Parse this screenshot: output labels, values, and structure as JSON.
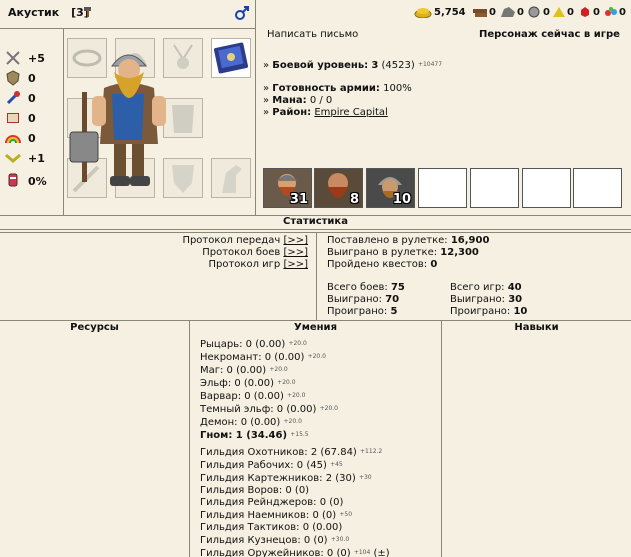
{
  "header": {
    "name": "Акустик",
    "level": "[3]",
    "resources": [
      {
        "icon": "gold-icon",
        "value": "5,754"
      },
      {
        "icon": "wood-icon",
        "value": "0"
      },
      {
        "icon": "ore-icon",
        "value": "0"
      },
      {
        "icon": "mercury-icon",
        "value": "0"
      },
      {
        "icon": "sulfur-icon",
        "value": "0"
      },
      {
        "icon": "crystal-icon",
        "value": "0"
      },
      {
        "icon": "gem-icon",
        "value": "0"
      }
    ]
  },
  "stats": [
    {
      "icon": "attack-icon",
      "value": "+5"
    },
    {
      "icon": "defense-icon",
      "value": "0"
    },
    {
      "icon": "spellpower-icon",
      "value": "0"
    },
    {
      "icon": "knowledge-icon",
      "value": "0"
    },
    {
      "icon": "luck-icon",
      "value": "0"
    },
    {
      "icon": "morale-icon",
      "value": "+1"
    },
    {
      "icon": "initiative-icon",
      "value": "0%"
    }
  ],
  "info": {
    "write_letter": "Написать письмо",
    "in_game": "Персонаж сейчас в игре",
    "combat_level_label": "Боевой уровень:",
    "combat_level_value": "3",
    "combat_level_exp": "(4523)",
    "combat_level_next": "+10477",
    "army_ready_label": "Готовность армии:",
    "army_ready_value": "100%",
    "mana_label": "Мана:",
    "mana_value": "0 / 0",
    "district_label": "Район:",
    "district_value": "Empire Capital"
  },
  "army": [
    {
      "name": "dwarf-warrior",
      "count": "31"
    },
    {
      "name": "dwarf-bearded",
      "count": "8"
    },
    {
      "name": "dwarf-helmet",
      "count": "10"
    }
  ],
  "statistics": {
    "title": "Статистика",
    "links": [
      {
        "label": "Протокол передач",
        "btn": "[>>]"
      },
      {
        "label": "Протокол боев",
        "btn": "[>>]"
      },
      {
        "label": "Протокол игр",
        "btn": "[>>]"
      }
    ],
    "roulette_bet_label": "Поставлено в рулетке:",
    "roulette_bet": "16,900",
    "roulette_won_label": "Выиграно в рулетке:",
    "roulette_won": "12,300",
    "quests_label": "Пройдено квестов:",
    "quests": "0",
    "battles": [
      {
        "label": "Всего боев:",
        "value": "75"
      },
      {
        "label": "Выиграно:",
        "value": "70"
      },
      {
        "label": "Проиграно:",
        "value": "5"
      }
    ],
    "games": [
      {
        "label": "Всего игр:",
        "value": "40"
      },
      {
        "label": "Выиграно:",
        "value": "30"
      },
      {
        "label": "Проиграно:",
        "value": "10"
      }
    ]
  },
  "columns": {
    "resources": "Ресурсы",
    "skills": "Умения",
    "talents": "Навыки"
  },
  "skills": [
    {
      "text": "Рыцарь: 0 (0.00)",
      "next": "+20.0",
      "bold": false
    },
    {
      "text": "Некромант: 0 (0.00)",
      "next": "+20.0",
      "bold": false
    },
    {
      "text": "Маг: 0 (0.00)",
      "next": "+20.0",
      "bold": false
    },
    {
      "text": "Эльф: 0 (0.00)",
      "next": "+20.0",
      "bold": false
    },
    {
      "text": "Варвар: 0 (0.00)",
      "next": "+20.0",
      "bold": false
    },
    {
      "text": "Темный эльф: 0 (0.00)",
      "next": "+20.0",
      "bold": false
    },
    {
      "text": "Демон: 0 (0.00)",
      "next": "+20.0",
      "bold": false
    },
    {
      "text": "Гном: 1 (34.46)",
      "next": "+15.5",
      "bold": true
    }
  ],
  "guilds": [
    {
      "text": "Гильдия Охотников: 2 (67.84)",
      "next": "+112.2"
    },
    {
      "text": "Гильдия Рабочих: 0 (45)",
      "next": "+45"
    },
    {
      "text": "Гильдия Картежников: 2 (30)",
      "next": "+30"
    },
    {
      "text": "Гильдия Воров: 0 (0)",
      "next": ""
    },
    {
      "text": "Гильдия Рейнджеров: 0 (0)",
      "next": ""
    },
    {
      "text": "Гильдия Наемников: 0 (0)",
      "next": "+50"
    },
    {
      "text": "Гильдия Тактиков: 0 (0.00)",
      "next": ""
    },
    {
      "text": "Гильдия Кузнецов: 0 (0)",
      "next": "+30.0"
    },
    {
      "text": "Гильдия Оружейников: 0 (0)",
      "next": "+104"
    }
  ],
  "guild_extra_btn": "(±)"
}
